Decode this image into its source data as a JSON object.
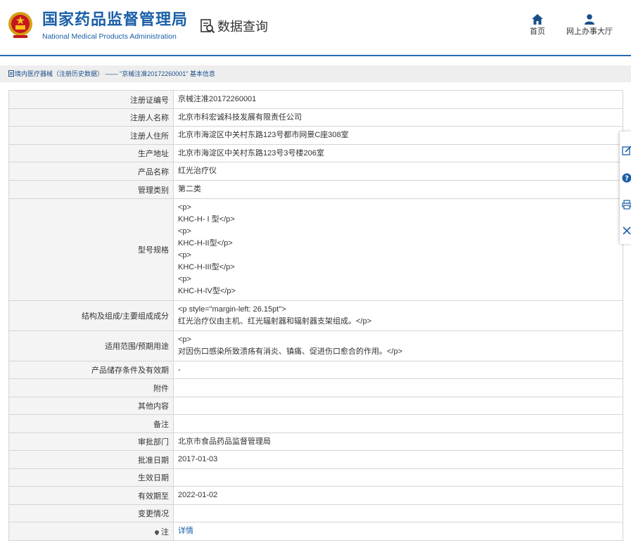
{
  "header": {
    "agency_cn": "国家药品监督管理局",
    "agency_en": "National Medical Products Administration",
    "section_title": "数据查询",
    "nav": [
      {
        "label": "首页",
        "icon": "home-icon"
      },
      {
        "label": "网上办事大厅",
        "icon": "user-icon"
      }
    ]
  },
  "breadcrumb": {
    "text": "境内医疗器械（注册历史数据） —— \"京械注准20172260001\" 基本信息"
  },
  "table": {
    "rows": [
      {
        "label": "注册证编号",
        "value": "京械注准20172260001"
      },
      {
        "label": "注册人名称",
        "value": "北京市科宏诚科技发展有限责任公司"
      },
      {
        "label": "注册人住所",
        "value": "北京市海淀区中关村东路123号都市网景C座308室"
      },
      {
        "label": "生产地址",
        "value": "北京市海淀区中关村东路123号3号楼206室"
      },
      {
        "label": "产品名称",
        "value": "红光治疗仪"
      },
      {
        "label": "管理类别",
        "value": "第二类"
      },
      {
        "label": "型号规格",
        "value": "<p>\nKHC-H- I 型</p>\n<p>\nKHC-H-II型</p>\n<p>\nKHC-H-III型</p>\n<p>\nKHC-H-IV型</p>"
      },
      {
        "label": "结构及组成/主要组成成分",
        "value": "<p style=\"margin-left: 26.15pt\">\n红光治疗仪由主机、红光辐射器和辐射器支架组成。</p>"
      },
      {
        "label": "适用范围/预期用途",
        "value": "<p>\n对因伤口感染所致溃疡有消炎、镇痛、促进伤口愈合的作用。</p>"
      },
      {
        "label": "产品储存条件及有效期",
        "value": "-"
      },
      {
        "label": "附件",
        "value": ""
      },
      {
        "label": "其他内容",
        "value": ""
      },
      {
        "label": "备注",
        "value": ""
      },
      {
        "label": "审批部门",
        "value": "北京市食品药品监督管理局"
      },
      {
        "label": "批准日期",
        "value": "2017-01-03"
      },
      {
        "label": "生效日期",
        "value": ""
      },
      {
        "label": "有效期至",
        "value": "2022-01-02"
      },
      {
        "label": "变更情况",
        "value": ""
      },
      {
        "label": "注",
        "value": "详情"
      }
    ]
  },
  "side_toolbar": [
    "edit-icon",
    "help-icon",
    "print-icon",
    "close-icon"
  ],
  "colors": {
    "brand": "#1a5fa8",
    "header_line": "#2a6ab3",
    "label_bg": "#f4f4f4",
    "border": "#d5d5d5"
  }
}
